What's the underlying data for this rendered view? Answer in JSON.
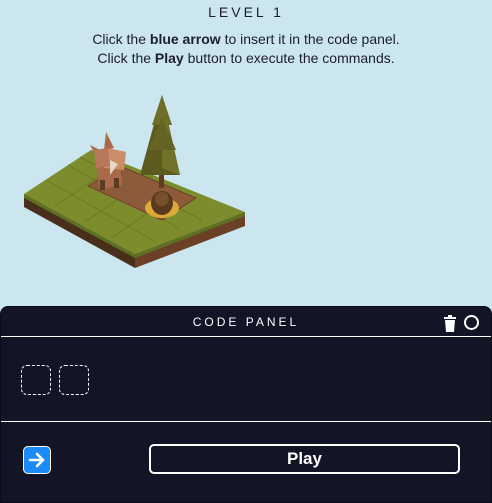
{
  "header": {
    "level_title": "LEVEL 1",
    "line1_pre": "Click the ",
    "line1_bold": "blue arrow",
    "line1_post": " to insert it in the code panel.",
    "line2_pre": "Click the ",
    "line2_bold": "Play",
    "line2_post": " button to execute the commands."
  },
  "scene": {
    "characters": [
      "fox"
    ],
    "objects": [
      "pine-tree",
      "pinecone"
    ],
    "colors": {
      "grass": "#7b8a2b",
      "dirt": "#8b5a3c",
      "tree": "#5a5a1e",
      "background": "#cbe6ef"
    }
  },
  "code_panel": {
    "title": "CODE PANEL",
    "icons": [
      "trash-icon",
      "circle-icon"
    ],
    "empty_slot_count": 2,
    "play_label": "Play",
    "command_icon": "right-arrow-icon",
    "colors": {
      "panel_bg": "#131426",
      "arrow_button": "#1d8bf5"
    }
  }
}
